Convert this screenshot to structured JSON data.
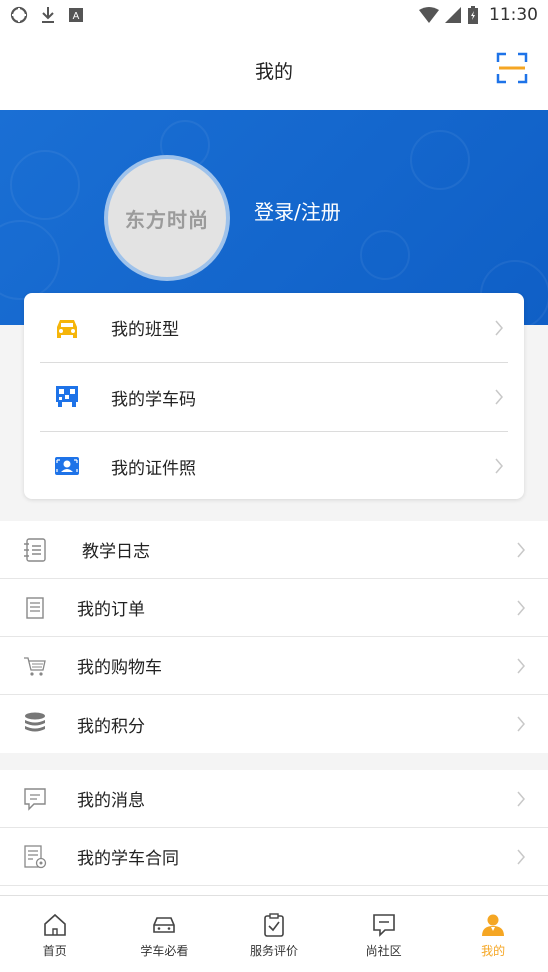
{
  "status_bar": {
    "time": "11:30"
  },
  "header": {
    "title": "我的",
    "scan_icon": "scan-icon"
  },
  "profile": {
    "avatar_text": "东方时尚",
    "login_label": "登录/注册"
  },
  "card_items": [
    {
      "label": "我的班型",
      "icon": "car-icon"
    },
    {
      "label": "我的学车码",
      "icon": "qr-code-icon"
    },
    {
      "label": "我的证件照",
      "icon": "id-photo-icon"
    }
  ],
  "list_group_1": [
    {
      "label": "教学日志",
      "icon": "notebook-icon"
    },
    {
      "label": "我的订单",
      "icon": "order-icon"
    },
    {
      "label": "我的购物车",
      "icon": "cart-icon"
    },
    {
      "label": "我的积分",
      "icon": "points-icon"
    }
  ],
  "list_group_2": [
    {
      "label": "我的消息",
      "icon": "message-icon"
    },
    {
      "label": "我的学车合同",
      "icon": "contract-icon"
    }
  ],
  "tabs": [
    {
      "label": "首页",
      "icon": "home-icon"
    },
    {
      "label": "学车必看",
      "icon": "car-outline-icon"
    },
    {
      "label": "服务评价",
      "icon": "clipboard-check-icon"
    },
    {
      "label": "尚社区",
      "icon": "chat-icon"
    },
    {
      "label": "我的",
      "icon": "user-icon",
      "active": true
    }
  ],
  "colors": {
    "accent": "#f5a623",
    "banner_blue": "#1565c8",
    "icon_blue": "#1e73e8",
    "icon_yellow": "#f5b50a"
  }
}
